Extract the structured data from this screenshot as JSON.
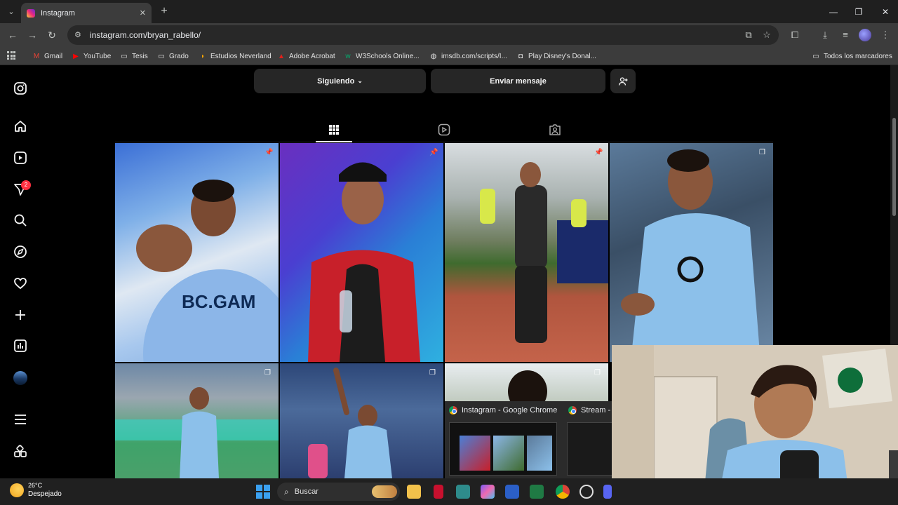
{
  "browser": {
    "tab_title": "Instagram",
    "tab_close": "✕",
    "new_tab": "+",
    "url": "instagram.com/bryan_rabello/",
    "window_controls": {
      "minimize": "—",
      "maximize": "❐",
      "close": "✕"
    }
  },
  "bookmarks": [
    {
      "label": "Gmail",
      "icon": "gmail-icon",
      "color": "#ea4335"
    },
    {
      "label": "YouTube",
      "icon": "youtube-icon",
      "color": "#ff0000"
    },
    {
      "label": "Tesis",
      "icon": "folder-icon",
      "color": "#c4c7c5"
    },
    {
      "label": "Grado",
      "icon": "folder-icon",
      "color": "#c4c7c5"
    },
    {
      "label": "Estudios Neverland",
      "icon": "neverland-icon",
      "color": "#f4a300"
    },
    {
      "label": "Adobe Acrobat",
      "icon": "acrobat-icon",
      "color": "#e0201b"
    },
    {
      "label": "W3Schools Online...",
      "icon": "w3schools-icon",
      "color": "#04aa6d"
    },
    {
      "label": "imsdb.com/scripts/I...",
      "icon": "globe-icon",
      "color": "#c4c7c5"
    },
    {
      "label": "Play Disney's Donal...",
      "icon": "gamepad-icon",
      "color": "#c4c7c5"
    }
  ],
  "all_bookmarks": "Todos los marcadores",
  "sidebar": {
    "notification_count": "2"
  },
  "profile": {
    "following_label": "Siguiendo",
    "message_label": "Enviar mensaje"
  },
  "taskbar": {
    "temperature": "26°C",
    "condition": "Despejado",
    "search_placeholder": "Buscar"
  },
  "switcher": {
    "item1": "Instagram - Google Chrome",
    "item2": "Stream - K"
  },
  "colors": {
    "accent_badge": "#ff3040",
    "page_background": "#000000",
    "button_background": "#262626"
  }
}
